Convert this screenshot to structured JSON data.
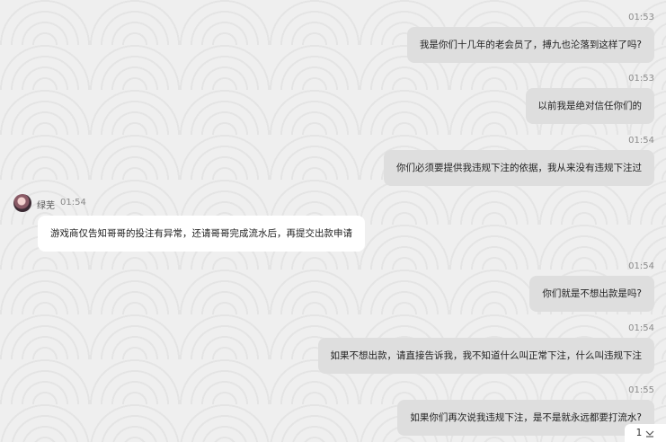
{
  "messages": [
    {
      "side": "right",
      "time": "01:53",
      "text": "我是你们十几年的老会员了，搏九也沦落到这样了吗?"
    },
    {
      "side": "right",
      "time": "01:53",
      "text": "以前我是绝对信任你们的"
    },
    {
      "side": "right",
      "time": "01:54",
      "text": "你们必须要提供我违规下注的依据，我从来没有违规下注过"
    },
    {
      "side": "left",
      "sender": "绿芜",
      "time": "01:54",
      "text": "游戏商仅告知哥哥的投注有异常，还请哥哥完成流水后，再提交出款申请"
    },
    {
      "side": "right",
      "time": "01:54",
      "text": "你们就是不想出款是吗?"
    },
    {
      "side": "right",
      "time": "01:54",
      "text": "如果不想出款，请直接告诉我，我不知道什么叫正常下注，什么叫违规下注"
    },
    {
      "side": "right",
      "time": "01:55",
      "text": "如果你们再次说我违规下注，是不是就永远都要打流水?"
    }
  ],
  "pager": {
    "count": "1",
    "icon": "chevron-down-icon"
  }
}
